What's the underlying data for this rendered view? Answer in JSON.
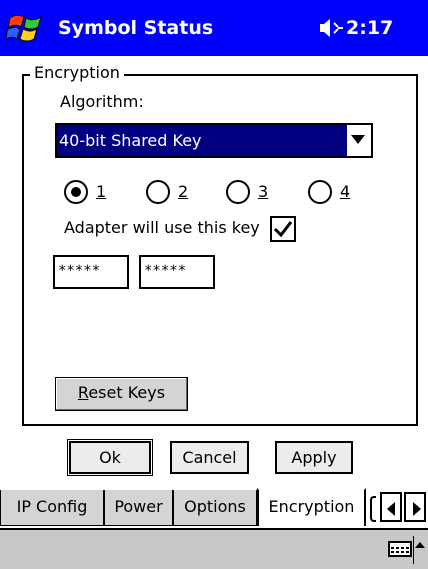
{
  "title_bar": {
    "title": "Symbol Status",
    "time": "2:17",
    "background": "#0000ff"
  },
  "encryption": {
    "group_label": "Encryption",
    "algorithm_label": "Algorithm:",
    "algorithm_value": "40-bit Shared Key",
    "key_options": [
      {
        "label": "1",
        "selected": true
      },
      {
        "label": "2",
        "selected": false
      },
      {
        "label": "3",
        "selected": false
      },
      {
        "label": "4",
        "selected": false
      }
    ],
    "adapter_label": "Adapter will use this key",
    "adapter_checked": true,
    "key_fields": [
      "*****",
      "*****"
    ],
    "reset_label": "Reset Keys"
  },
  "dialog_buttons": {
    "ok": "Ok",
    "cancel": "Cancel",
    "apply": "Apply"
  },
  "tabs": [
    {
      "label": "IP Config",
      "active": false
    },
    {
      "label": "Power",
      "active": false
    },
    {
      "label": "Options",
      "active": false
    },
    {
      "label": "Encryption",
      "active": true
    }
  ],
  "icons": {
    "start": "windows-flag-icon",
    "volume": "speaker-icon",
    "keyboard": "keyboard-icon",
    "tab_scroll_left": "arrow-left-icon",
    "tab_scroll_right": "arrow-right-icon",
    "sip_menu": "caret-up-icon"
  },
  "colors": {
    "selection": "#000080",
    "menubar": "#c8c8c8"
  }
}
